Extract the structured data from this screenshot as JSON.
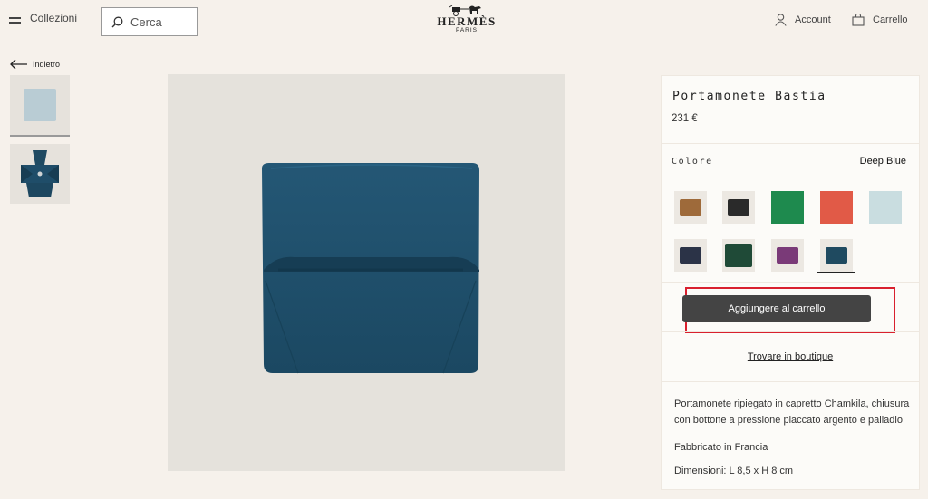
{
  "header": {
    "menu_label": "Collezioni",
    "search_placeholder": "Cerca",
    "logo_name": "HERMÈS",
    "logo_city": "PARIS",
    "account_label": "Account",
    "cart_label": "Carrello"
  },
  "gallery": {
    "back_label": "Indietro"
  },
  "product": {
    "title": "Portamonete Bastia",
    "price": "231 €",
    "color_label": "Colore",
    "color_value": "Deep Blue",
    "swatches": [
      {
        "name": "gold-tan",
        "color": "#9e6a3a"
      },
      {
        "name": "black",
        "color": "#2a2a2a"
      },
      {
        "name": "green",
        "color": "#1e8a4e"
      },
      {
        "name": "red",
        "color": "#e15a47"
      },
      {
        "name": "light-blue",
        "color": "#c9dde0"
      },
      {
        "name": "navy",
        "color": "#2b3347"
      },
      {
        "name": "dark-green",
        "color": "#1f4a37"
      },
      {
        "name": "purple",
        "color": "#7a3a78"
      },
      {
        "name": "deep-blue",
        "color": "#1f4a60",
        "selected": true
      }
    ],
    "add_to_cart_label": "Aggiungere al carrello",
    "boutique_label": "Trovare in boutique",
    "description": "Portamonete ripiegato in capretto Chamkila, chiusura con bottone a pressione placcato argento e palladio",
    "made_in": "Fabbricato in Francia",
    "dimensions": "Dimensioni: L 8,5 x H 8 cm"
  },
  "colors": {
    "background": "#f6f1eb",
    "button_dark": "#444444",
    "highlight_red": "#d9202e",
    "pouch_blue": "#1f4d69"
  }
}
